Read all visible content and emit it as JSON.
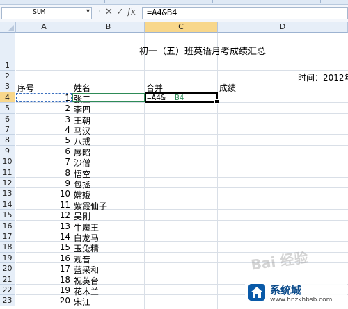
{
  "namebox": {
    "value": "SUM"
  },
  "formula": {
    "value": "=A4&B4"
  },
  "columns": [
    {
      "id": "corner",
      "label": ""
    },
    {
      "id": "A",
      "label": "A"
    },
    {
      "id": "B",
      "label": "B"
    },
    {
      "id": "C",
      "label": "C"
    },
    {
      "id": "D",
      "label": "D"
    }
  ],
  "sheet": {
    "title": "初一（五）班英语月考成绩汇总",
    "time_label": "时间：2012年",
    "headers": {
      "a3": "序号",
      "b3": "姓名",
      "c3": "合并",
      "d3": "成绩"
    },
    "editing_formula": {
      "prefix": "=A4&",
      "ref_b": "B4"
    },
    "rows": [
      {
        "row": "1",
        "seq": "",
        "name": ""
      },
      {
        "row": "2",
        "seq": "",
        "name": ""
      },
      {
        "row": "3",
        "seq": "",
        "name": ""
      },
      {
        "row": "4",
        "seq": "1",
        "name": "张三"
      },
      {
        "row": "5",
        "seq": "2",
        "name": "李四"
      },
      {
        "row": "6",
        "seq": "3",
        "name": "王朝"
      },
      {
        "row": "7",
        "seq": "4",
        "name": "马汉"
      },
      {
        "row": "8",
        "seq": "5",
        "name": "八戒"
      },
      {
        "row": "9",
        "seq": "6",
        "name": "展昭"
      },
      {
        "row": "10",
        "seq": "7",
        "name": "沙僧"
      },
      {
        "row": "11",
        "seq": "8",
        "name": "悟空"
      },
      {
        "row": "12",
        "seq": "9",
        "name": "包拯"
      },
      {
        "row": "13",
        "seq": "10",
        "name": "嫦娥"
      },
      {
        "row": "14",
        "seq": "11",
        "name": "紫霞仙子"
      },
      {
        "row": "15",
        "seq": "12",
        "name": "吴刚"
      },
      {
        "row": "16",
        "seq": "13",
        "name": "牛魔王"
      },
      {
        "row": "17",
        "seq": "14",
        "name": "白龙马"
      },
      {
        "row": "18",
        "seq": "15",
        "name": "玉兔精"
      },
      {
        "row": "19",
        "seq": "16",
        "name": "观音"
      },
      {
        "row": "20",
        "seq": "17",
        "name": "蓝采和"
      },
      {
        "row": "21",
        "seq": "18",
        "name": "祝英台"
      },
      {
        "row": "22",
        "seq": "19",
        "name": "花木兰"
      },
      {
        "row": "23",
        "seq": "20",
        "name": "宋江"
      }
    ]
  },
  "watermark": {
    "text": "Bai 经验"
  },
  "brand": {
    "name": "系统城",
    "url": "www.hnzkhbsb.com"
  }
}
